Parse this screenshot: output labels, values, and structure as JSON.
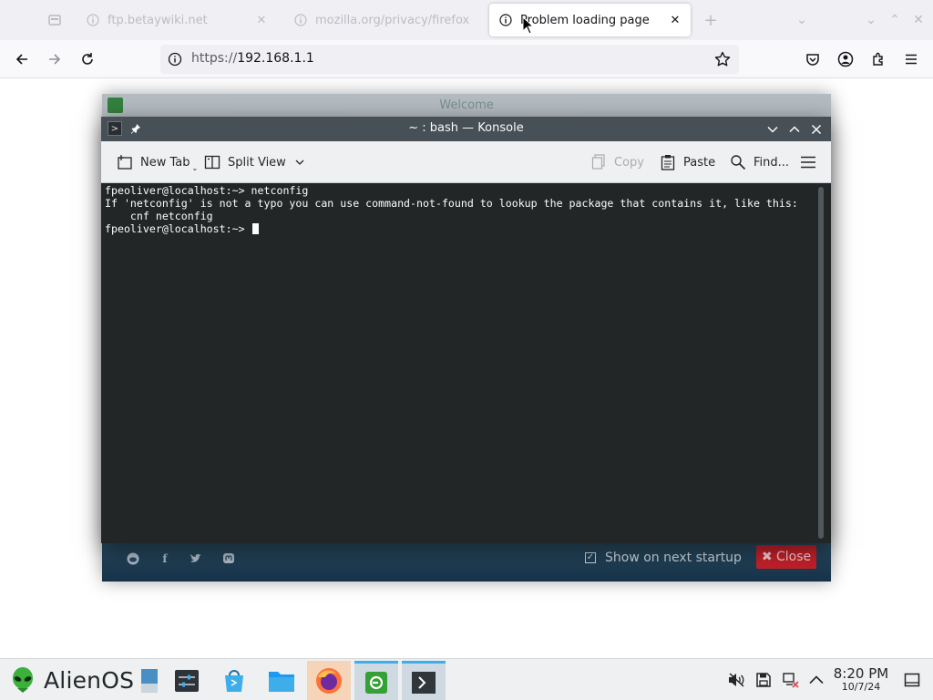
{
  "browser": {
    "tabs": [
      {
        "title": "ftp.betaywiki.net",
        "active": false
      },
      {
        "title": "mozilla.org/privacy/firefox",
        "active": false
      },
      {
        "title": "Problem loading page",
        "active": true
      }
    ],
    "url": {
      "protocol": "https://",
      "host": "192.168.1.1"
    }
  },
  "welcome": {
    "title": "Welcome",
    "show_on_startup": "Show on next startup",
    "close_label": "✖ Close"
  },
  "konsole": {
    "title": "~ : bash — Konsole",
    "toolbar": {
      "new_tab": "New Tab",
      "split_view": "Split View",
      "copy": "Copy",
      "paste": "Paste",
      "find": "Find..."
    },
    "terminal_lines": [
      "fpeoliver@localhost:~> netconfig",
      "If 'netconfig' is not a typo you can use command-not-found to lookup the package that contains it, like this:",
      "    cnf netconfig"
    ],
    "prompt": "fpeoliver@localhost:~> "
  },
  "taskbar": {
    "start_label": "AlienOS",
    "clock_time": "8:20 PM",
    "clock_date": "10/7/24"
  },
  "colors": {
    "konsole_titlebar": "#475057",
    "terminal_bg": "#232627",
    "welcome_close": "#c0202a",
    "taskbar_active": "#3daee9"
  }
}
